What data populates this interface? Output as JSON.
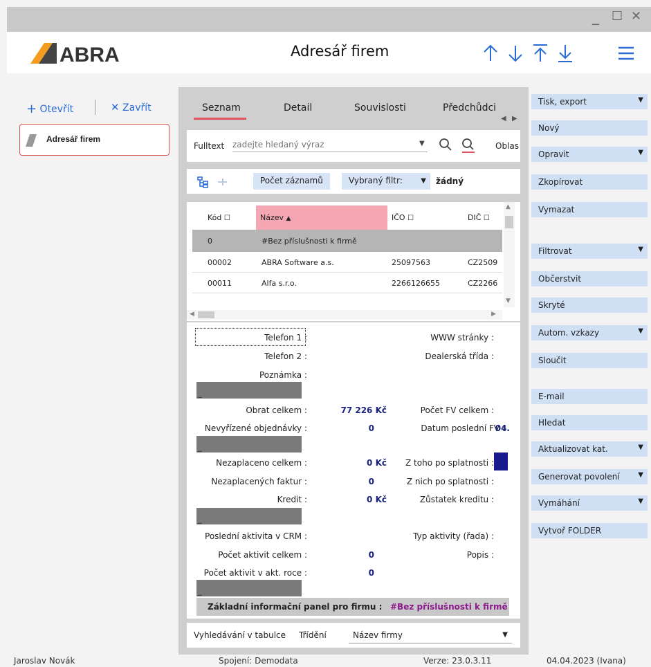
{
  "window": {
    "minimize": "_",
    "maximize": "☐",
    "close": "✕"
  },
  "header": {
    "logo_text": "ABRA",
    "title": "Adresář firem"
  },
  "left": {
    "open": "Otevřít",
    "close": "Zavřít",
    "tab_label": "Adresář firem"
  },
  "tabs": [
    "Seznam",
    "Detail",
    "Souvislosti",
    "Předchůdci"
  ],
  "search": {
    "label": "Fulltext",
    "placeholder": "zadejte hledaný výraz",
    "area_label": "Oblas"
  },
  "toolbar": {
    "count_button": "Počet záznamů",
    "filter_label": "Vybraný filtr:",
    "filter_value": "žádný"
  },
  "grid": {
    "columns": [
      "Kód",
      "Název",
      "IČO",
      "DIČ"
    ],
    "rows": [
      {
        "code": "0",
        "name": "#Bez příslušnosti k firmě",
        "ico": "",
        "dic": ""
      },
      {
        "code": "00002",
        "name": "ABRA Software a.s.",
        "ico": "25097563",
        "dic": "CZ2509"
      },
      {
        "code": "00011",
        "name": "Alfa s.r.o.",
        "ico": "2266126655",
        "dic": "CZ2266"
      }
    ]
  },
  "detail": {
    "phone1": "Telefon 1 :",
    "www": "WWW stránky :",
    "phone2": "Telefon 2 :",
    "dealer": "Dealerská třída :",
    "note": "Poznámka :",
    "turnover": "Obrat celkem :",
    "turnover_val": "77 226 Kč",
    "fv_count": "Počet FV celkem :",
    "open_orders": "Nevyřízené objednávky :",
    "open_orders_val": "0",
    "last_fv": "Datum poslední FV :",
    "last_fv_val": "04.",
    "unpaid_total": "Nezaplaceno celkem :",
    "unpaid_total_val": "0 Kč",
    "overdue_of": "Z toho po splatnosti :",
    "unpaid_inv": "Nezaplacených faktur :",
    "unpaid_inv_val": "0",
    "overdue_inv": "Z nich po splatnosti :",
    "credit": "Kredit :",
    "credit_val": "0 Kč",
    "credit_bal": "Zůstatek kreditu :",
    "crm_last": "Poslední aktivita v CRM :",
    "activity_type": "Typ aktivity (řada) :",
    "act_total": "Počet aktivit celkem :",
    "act_total_val": "0",
    "desc": "Popis :",
    "act_year": "Počet aktivit v akt. roce :",
    "act_year_val": "0",
    "bar_mark": "_",
    "panel_label": "Základní informační panel pro firmu :",
    "panel_value": "#Bez příslušnosti k firmě"
  },
  "footer": {
    "table_search": "Vyhledávání v tabulce",
    "sort_label": "Třídění",
    "sort_value": "Název firmy"
  },
  "right_buttons": [
    {
      "label": "Tisk, export",
      "dd": true
    },
    {
      "label": "Nový",
      "dd": false
    },
    {
      "label": "Opravit",
      "dd": true
    },
    {
      "label": "Zkopírovat",
      "dd": false
    },
    {
      "label": "Vymazat",
      "dd": false
    },
    {
      "label": "Filtrovat",
      "dd": true
    },
    {
      "label": "Občerstvit",
      "dd": false
    },
    {
      "label": "Skryté",
      "dd": false
    },
    {
      "label": "Autom. vzkazy",
      "dd": true
    },
    {
      "label": "Sloučit",
      "dd": false
    },
    {
      "label": "E-mail",
      "dd": false
    },
    {
      "label": "Hledat",
      "dd": false
    },
    {
      "label": "Aktualizovat kat.",
      "dd": true
    },
    {
      "label": "Generovat povolení",
      "dd": true
    },
    {
      "label": "Vymáhání",
      "dd": true
    },
    {
      "label": "Vytvoř FOLDER",
      "dd": false
    }
  ],
  "status": {
    "user": "Jaroslav Novák",
    "connection": "Spojení: Demodata",
    "version": "Verze: 23.0.3.11",
    "date": "04.04.2023 (Ivana)"
  },
  "colors": {
    "accent": "#2a6bd6",
    "sort_header": "#f4a7b3",
    "selected_row": "#b5b5b5",
    "tab_underline": "#e0525e"
  }
}
